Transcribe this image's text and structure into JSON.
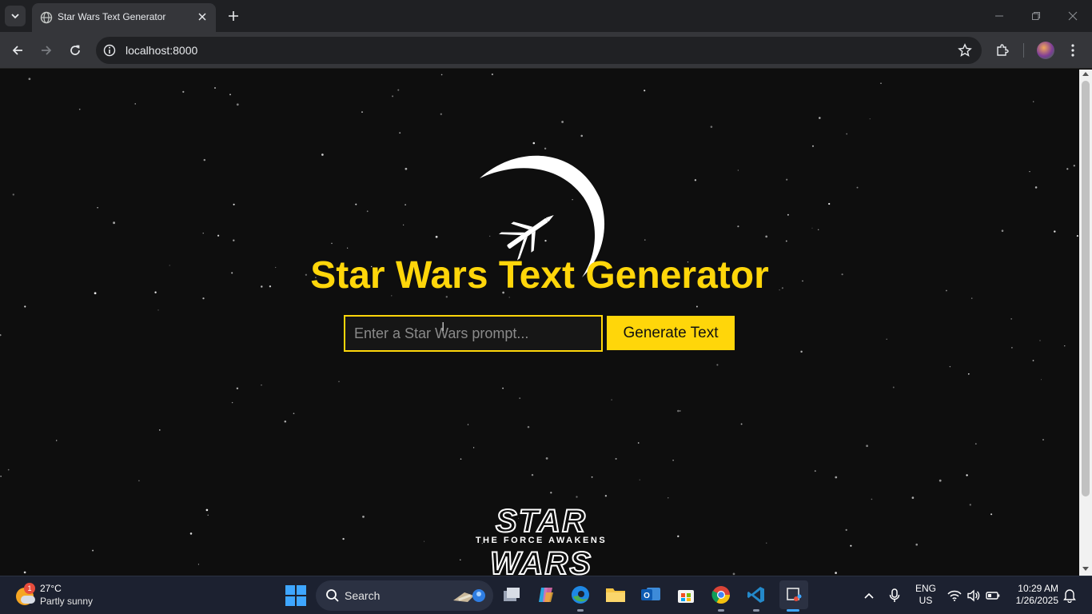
{
  "browser": {
    "tab_title": "Star Wars Text Generator",
    "url": "localhost:8000"
  },
  "page": {
    "heading": "Star Wars Text Generator",
    "prompt_placeholder": "Enter a Star Wars prompt...",
    "prompt_value": "",
    "generate_button": "Generate Text",
    "logo_top": "STAR",
    "logo_sub": "THE FORCE AWAKENS",
    "logo_bottom": "WARS",
    "accent_color": "#ffd60a",
    "background_color": "#0e0e0e"
  },
  "taskbar": {
    "weather_badge": "1",
    "weather_temp": "27°C",
    "weather_condition": "Partly sunny",
    "search_label": "Search",
    "apps": [
      "task-view",
      "copilot",
      "edge",
      "file-explorer",
      "outlook",
      "microsoft-store",
      "chrome",
      "vscode",
      "snipping-tool"
    ],
    "lang_line1": "ENG",
    "lang_line2": "US",
    "time": "10:29 AM",
    "date": "1/26/2025"
  }
}
